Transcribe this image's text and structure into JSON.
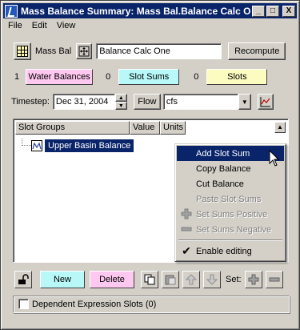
{
  "window": {
    "title": "Mass Balance Summary: Mass Bal.Balance Calc One",
    "min_label": "_",
    "max_label": "□",
    "close_label": "X"
  },
  "menu": [
    "File",
    "Edit",
    "View"
  ],
  "toolbar": {
    "mass_bal_label": "Mass Bal",
    "name_value": "Balance Calc One",
    "recompute_label": "Recompute"
  },
  "counts": {
    "water_balances_count": "1",
    "water_balances_label": "Water Balances",
    "slot_sums_count": "0",
    "slot_sums_label": "Slot Sums",
    "slots_count": "0",
    "slots_label": "Slots"
  },
  "timestep": {
    "label": "Timestep:",
    "date_value": "Dec 31, 2004",
    "flow_label": "Flow",
    "unit_value": "cfs"
  },
  "table": {
    "columns": [
      "Slot Groups",
      "Value",
      "Units"
    ],
    "rows": [
      {
        "name": "Upper Basin Balance"
      }
    ]
  },
  "context_menu": {
    "items": [
      {
        "label": "Add Slot Sum",
        "icon": "",
        "state": "highlighted"
      },
      {
        "label": "Copy Balance",
        "icon": "",
        "state": "enabled"
      },
      {
        "label": "Cut Balance",
        "icon": "",
        "state": "enabled"
      },
      {
        "label": "Paste Slot Sums",
        "icon": "",
        "state": "disabled"
      },
      {
        "label": "Set Sums Positive",
        "icon": "plus-icon",
        "state": "disabled"
      },
      {
        "label": "Set Sums Negative",
        "icon": "minus-icon",
        "state": "disabled"
      },
      {
        "label": "Enable editing",
        "icon": "check-icon",
        "state": "checked"
      }
    ]
  },
  "bottom": {
    "new_label": "New",
    "delete_label": "Delete",
    "set_label": "Set:"
  },
  "dependent": {
    "label": "Dependent Expression Slots (0)"
  },
  "colors": {
    "water_balances_bg": "#ffc8f0",
    "slot_sums_bg": "#b8f8f8",
    "slots_bg": "#fcfcc0",
    "new_bg": "#b8f8f8",
    "delete_bg": "#ffc8f0",
    "selection": "#0a246a"
  }
}
